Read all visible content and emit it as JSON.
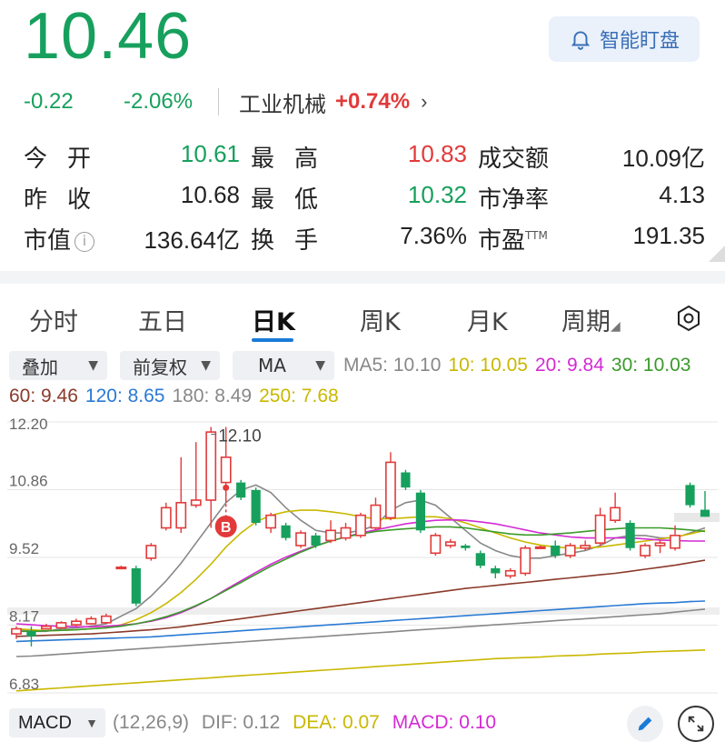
{
  "quote": {
    "price": "10.46",
    "change_abs": "-0.22",
    "change_pct": "-2.06%",
    "industry_name": "工业机械",
    "industry_change": "+0.74%",
    "industry_arrow": "›",
    "alert_label": "智能盯盘"
  },
  "stats": [
    [
      {
        "label": "今开",
        "value": "10.61",
        "color": "green"
      },
      {
        "label": "最高",
        "value": "10.83",
        "color": "red"
      },
      {
        "label": "成交额",
        "value": "10.09亿",
        "color": "black"
      }
    ],
    [
      {
        "label": "昨收",
        "value": "10.68",
        "color": "black"
      },
      {
        "label": "最低",
        "value": "10.32",
        "color": "green"
      },
      {
        "label": "市净率",
        "value": "4.13",
        "color": "black"
      }
    ],
    [
      {
        "label": "市值",
        "value": "136.64亿",
        "color": "black"
      },
      {
        "label": "换手",
        "value": "7.36%",
        "color": "black"
      },
      {
        "label": "市盈",
        "value": "191.35",
        "color": "black"
      }
    ]
  ],
  "stats_extra": {
    "info_glyph": "i",
    "pe_suffix": "TTM"
  },
  "tabs": [
    "分时",
    "五日",
    "日K",
    "周K",
    "月K",
    "周期"
  ],
  "active_tab": "日K",
  "controls": {
    "overlay": "叠加",
    "adjust": "前复权",
    "indicator": "MA",
    "arrow": "▼"
  },
  "ma_legend": [
    {
      "label": "MA5: 10.10",
      "color": "#888888"
    },
    {
      "label": "10: 10.05",
      "color": "#c9b800"
    },
    {
      "label": "20: 9.84",
      "color": "#d42ad4"
    },
    {
      "label": "30: 10.03",
      "color": "#3a9a2a"
    },
    {
      "label": "60: 9.46",
      "color": "#8b3a2a"
    },
    {
      "label": "120: 8.65",
      "color": "#2a7ad4"
    },
    {
      "label": "180: 8.49",
      "color": "#888888"
    },
    {
      "label": "250: 7.68",
      "color": "#c9b800"
    }
  ],
  "chart_data": {
    "type": "candlestick",
    "y_ticks": [
      "12.20",
      "10.86",
      "9.52",
      "8.17",
      "6.83"
    ],
    "ylim": [
      6.83,
      12.2
    ],
    "high_label": "12.10",
    "buy_marker": "B",
    "candles": [
      {
        "o": 8.0,
        "c": 8.1,
        "h": 8.15,
        "l": 7.9
      },
      {
        "o": 8.05,
        "c": 7.95,
        "h": 8.15,
        "l": 7.75
      },
      {
        "o": 8.1,
        "c": 8.15,
        "h": 8.2,
        "l": 8.1
      },
      {
        "o": 8.12,
        "c": 8.22,
        "h": 8.25,
        "l": 8.1
      },
      {
        "o": 8.18,
        "c": 8.25,
        "h": 8.3,
        "l": 8.15
      },
      {
        "o": 8.2,
        "c": 8.3,
        "h": 8.35,
        "l": 8.18
      },
      {
        "o": 8.22,
        "c": 8.35,
        "h": 8.4,
        "l": 8.2
      },
      {
        "o": 9.3,
        "c": 9.32,
        "h": 9.35,
        "l": 9.28
      },
      {
        "o": 9.3,
        "c": 8.6,
        "h": 9.35,
        "l": 8.55
      },
      {
        "o": 9.5,
        "c": 9.75,
        "h": 9.8,
        "l": 9.45
      },
      {
        "o": 10.1,
        "c": 10.5,
        "h": 10.6,
        "l": 10.05
      },
      {
        "o": 10.1,
        "c": 10.6,
        "h": 11.5,
        "l": 10.0
      },
      {
        "o": 10.55,
        "c": 10.65,
        "h": 11.8,
        "l": 10.5
      },
      {
        "o": 10.65,
        "c": 12.0,
        "h": 12.1,
        "l": 10.1
      },
      {
        "o": 11.0,
        "c": 11.5,
        "h": 12.1,
        "l": 10.6
      },
      {
        "o": 11.0,
        "c": 10.7,
        "h": 11.05,
        "l": 10.65
      },
      {
        "o": 10.85,
        "c": 10.2,
        "h": 10.9,
        "l": 10.15
      },
      {
        "o": 10.1,
        "c": 10.35,
        "h": 10.4,
        "l": 10.0
      },
      {
        "o": 10.15,
        "c": 9.9,
        "h": 10.2,
        "l": 9.85
      },
      {
        "o": 9.75,
        "c": 10.0,
        "h": 10.05,
        "l": 9.7
      },
      {
        "o": 9.95,
        "c": 9.75,
        "h": 10.0,
        "l": 9.7
      },
      {
        "o": 9.85,
        "c": 10.05,
        "h": 10.25,
        "l": 9.8
      },
      {
        "o": 9.9,
        "c": 10.1,
        "h": 10.2,
        "l": 9.85
      },
      {
        "o": 9.95,
        "c": 10.35,
        "h": 10.4,
        "l": 9.9
      },
      {
        "o": 10.1,
        "c": 10.55,
        "h": 10.7,
        "l": 10.05
      },
      {
        "o": 10.3,
        "c": 11.4,
        "h": 11.6,
        "l": 10.25
      },
      {
        "o": 11.2,
        "c": 10.9,
        "h": 11.25,
        "l": 10.85
      },
      {
        "o": 10.8,
        "c": 10.05,
        "h": 10.85,
        "l": 10.0
      },
      {
        "o": 9.6,
        "c": 9.95,
        "h": 10.0,
        "l": 9.55
      },
      {
        "o": 9.75,
        "c": 9.82,
        "h": 9.88,
        "l": 9.7
      },
      {
        "o": 9.75,
        "c": 9.7,
        "h": 9.78,
        "l": 9.65
      },
      {
        "o": 9.6,
        "c": 9.35,
        "h": 9.65,
        "l": 9.3
      },
      {
        "o": 9.3,
        "c": 9.2,
        "h": 9.35,
        "l": 9.1
      },
      {
        "o": 9.15,
        "c": 9.25,
        "h": 9.3,
        "l": 9.1
      },
      {
        "o": 9.2,
        "c": 9.7,
        "h": 9.75,
        "l": 9.15
      },
      {
        "o": 9.7,
        "c": 9.72,
        "h": 9.75,
        "l": 9.68
      },
      {
        "o": 9.75,
        "c": 9.55,
        "h": 9.85,
        "l": 9.5
      },
      {
        "o": 9.55,
        "c": 9.75,
        "h": 9.8,
        "l": 9.5
      },
      {
        "o": 9.7,
        "c": 9.75,
        "h": 9.85,
        "l": 9.65
      },
      {
        "o": 9.8,
        "c": 10.35,
        "h": 10.5,
        "l": 9.75
      },
      {
        "o": 10.25,
        "c": 10.5,
        "h": 10.8,
        "l": 10.2
      },
      {
        "o": 10.2,
        "c": 9.7,
        "h": 10.25,
        "l": 9.65
      },
      {
        "o": 9.55,
        "c": 9.75,
        "h": 9.8,
        "l": 9.5
      },
      {
        "o": 9.75,
        "c": 9.8,
        "h": 9.85,
        "l": 9.6
      },
      {
        "o": 9.7,
        "c": 9.95,
        "h": 10.15,
        "l": 9.65
      },
      {
        "o": 10.95,
        "c": 10.55,
        "h": 11.0,
        "l": 10.5
      },
      {
        "o": 10.46,
        "c": 10.32,
        "h": 10.83,
        "l": 10.32
      }
    ],
    "series": [
      {
        "name": "MA5",
        "color": "#888888",
        "values": [
          8.1,
          8.05,
          8.05,
          8.1,
          8.12,
          8.15,
          8.2,
          8.35,
          8.5,
          8.75,
          9.05,
          9.4,
          9.8,
          10.2,
          10.6,
          10.85,
          10.95,
          10.8,
          10.5,
          10.25,
          10.05,
          10.0,
          10.0,
          10.05,
          10.15,
          10.45,
          10.6,
          10.65,
          10.55,
          10.3,
          10.05,
          9.8,
          9.65,
          9.55,
          9.5,
          9.5,
          9.55,
          9.6,
          9.65,
          9.75,
          9.9,
          9.95,
          9.95,
          9.9,
          9.9,
          10.0,
          10.1
        ]
      },
      {
        "name": "10",
        "color": "#c9b800",
        "values": [
          8.1,
          8.08,
          8.06,
          8.07,
          8.08,
          8.1,
          8.12,
          8.18,
          8.28,
          8.42,
          8.6,
          8.82,
          9.08,
          9.38,
          9.72,
          10.0,
          10.22,
          10.35,
          10.42,
          10.45,
          10.45,
          10.42,
          10.38,
          10.32,
          10.28,
          10.28,
          10.3,
          10.32,
          10.32,
          10.28,
          10.2,
          10.1,
          10.0,
          9.9,
          9.82,
          9.76,
          9.72,
          9.7,
          9.7,
          9.72,
          9.76,
          9.8,
          9.84,
          9.88,
          9.92,
          9.98,
          10.05
        ]
      },
      {
        "name": "20",
        "color": "#d42ad4",
        "values": [
          8.2,
          8.18,
          8.16,
          8.15,
          8.14,
          8.14,
          8.15,
          8.17,
          8.2,
          8.25,
          8.32,
          8.42,
          8.55,
          8.7,
          8.88,
          9.05,
          9.22,
          9.38,
          9.52,
          9.64,
          9.75,
          9.84,
          9.92,
          10.0,
          10.06,
          10.12,
          10.18,
          10.22,
          10.25,
          10.26,
          10.25,
          10.22,
          10.18,
          10.12,
          10.06,
          10.0,
          9.96,
          9.92,
          9.9,
          9.9,
          9.9,
          9.9,
          9.88,
          9.86,
          9.85,
          9.84,
          9.84
        ]
      },
      {
        "name": "30",
        "color": "#3a9a2a",
        "values": [
          8.05,
          8.05,
          8.06,
          8.07,
          8.08,
          8.1,
          8.12,
          8.15,
          8.2,
          8.26,
          8.34,
          8.44,
          8.56,
          8.7,
          8.86,
          9.02,
          9.18,
          9.34,
          9.48,
          9.62,
          9.74,
          9.84,
          9.92,
          9.98,
          10.03,
          10.06,
          10.08,
          10.1,
          10.12,
          10.12,
          10.1,
          10.06,
          10.02,
          9.98,
          9.96,
          9.96,
          9.98,
          10.0,
          10.03,
          10.06,
          10.08,
          10.1,
          10.1,
          10.1,
          10.08,
          10.06,
          10.03
        ]
      },
      {
        "name": "60",
        "color": "#8b3a2a",
        "values": [
          7.95,
          7.96,
          7.97,
          7.98,
          7.99,
          8.0,
          8.02,
          8.04,
          8.06,
          8.08,
          8.11,
          8.14,
          8.18,
          8.22,
          8.26,
          8.3,
          8.34,
          8.38,
          8.42,
          8.46,
          8.5,
          8.54,
          8.58,
          8.62,
          8.66,
          8.7,
          8.74,
          8.78,
          8.82,
          8.86,
          8.9,
          8.93,
          8.96,
          8.99,
          9.02,
          9.05,
          9.08,
          9.11,
          9.14,
          9.17,
          9.2,
          9.24,
          9.28,
          9.32,
          9.36,
          9.41,
          9.46
        ]
      },
      {
        "name": "120",
        "color": "#2a7ad4",
        "values": [
          7.85,
          7.86,
          7.87,
          7.88,
          7.89,
          7.9,
          7.91,
          7.92,
          7.93,
          7.94,
          7.96,
          7.98,
          8.0,
          8.02,
          8.04,
          8.06,
          8.08,
          8.1,
          8.12,
          8.14,
          8.16,
          8.18,
          8.2,
          8.22,
          8.24,
          8.26,
          8.28,
          8.3,
          8.32,
          8.34,
          8.36,
          8.38,
          8.4,
          8.42,
          8.44,
          8.46,
          8.48,
          8.5,
          8.52,
          8.54,
          8.56,
          8.58,
          8.6,
          8.61,
          8.62,
          8.64,
          8.65
        ]
      },
      {
        "name": "180",
        "color": "#888888",
        "values": [
          7.55,
          7.56,
          7.58,
          7.6,
          7.62,
          7.64,
          7.66,
          7.68,
          7.7,
          7.72,
          7.74,
          7.76,
          7.78,
          7.8,
          7.82,
          7.84,
          7.86,
          7.88,
          7.9,
          7.92,
          7.94,
          7.96,
          7.98,
          8.0,
          8.02,
          8.04,
          8.06,
          8.08,
          8.1,
          8.12,
          8.14,
          8.16,
          8.18,
          8.2,
          8.22,
          8.24,
          8.26,
          8.28,
          8.3,
          8.32,
          8.34,
          8.36,
          8.38,
          8.4,
          8.43,
          8.46,
          8.49
        ]
      },
      {
        "name": "250",
        "color": "#c9b800",
        "values": [
          6.87,
          6.89,
          6.91,
          6.93,
          6.95,
          6.97,
          6.99,
          7.01,
          7.03,
          7.05,
          7.07,
          7.09,
          7.11,
          7.13,
          7.15,
          7.17,
          7.19,
          7.21,
          7.23,
          7.25,
          7.27,
          7.29,
          7.31,
          7.33,
          7.35,
          7.37,
          7.39,
          7.41,
          7.43,
          7.45,
          7.47,
          7.49,
          7.51,
          7.52,
          7.53,
          7.54,
          7.56,
          7.57,
          7.58,
          7.6,
          7.61,
          7.62,
          7.64,
          7.65,
          7.66,
          7.67,
          7.68
        ]
      }
    ]
  },
  "macd": {
    "selector": "MACD",
    "params": "(12,26,9)",
    "dif": "DIF: 0.12",
    "dea": "DEA: 0.07",
    "macd": "MACD: 0.10",
    "dif_color": "#888888",
    "dea_color": "#c9b800",
    "macd_color": "#d42ad4"
  }
}
